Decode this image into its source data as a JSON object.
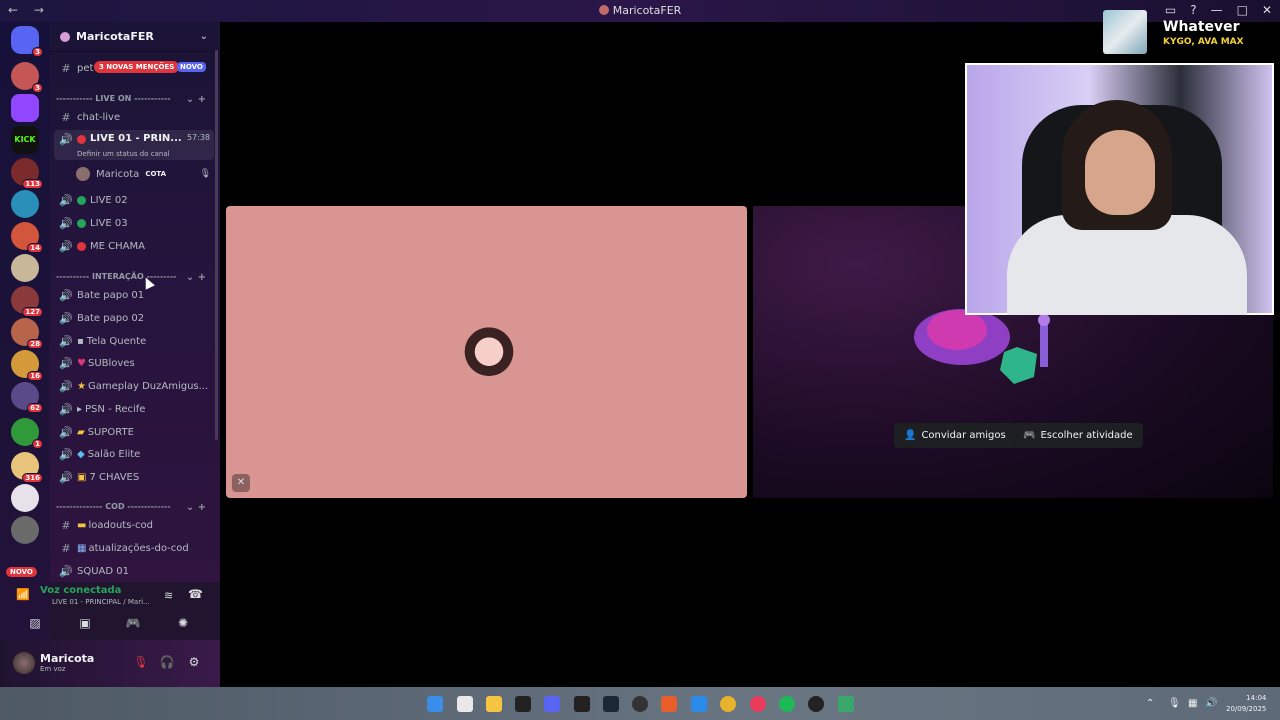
{
  "window": {
    "title": "MaricotaFER",
    "nav": "← →"
  },
  "server": {
    "name": "MaricotaFER"
  },
  "pet_row": {
    "label": "pet",
    "mentions_badge": "3 NOVAS MENÇÕES",
    "new_badge": "NOVO"
  },
  "categories": {
    "live_on": "----------- LIVE ON -----------",
    "interacao": "---------- INTERAÇÃO ---------",
    "cod": "-------------- COD -------------"
  },
  "channels": {
    "chat_live": "chat-live",
    "live01": "LIVE 01 - PRIN...",
    "live01_timer": "57:38",
    "live01_status": "Definir um status do canal",
    "member_name": "Maricota",
    "member_tag": "COTA",
    "live02": "LIVE 02",
    "live03": "LIVE 03",
    "me_chama": "ME CHAMA",
    "bate01": "Bate papo 01",
    "bate02": "Bate papo 02",
    "tela_quente": "Tela Quente",
    "subloves": "SUBloves",
    "gameplay": "Gameplay DuzAmigus...",
    "psn": "PSN - Recife",
    "suporte": "SUPORTE",
    "salao": "Salão Elite",
    "chaves": "7 CHAVES",
    "loadouts": "loadouts-cod",
    "atualizacoes": "atualizações-do-cod",
    "squad01": "SQUAD 01"
  },
  "guild_badges": [
    "3",
    "3",
    "113",
    "14",
    "127",
    "28",
    "16",
    "62",
    "1",
    "316"
  ],
  "guild_novo": "NOVO",
  "voice": {
    "title": "Voz conectada",
    "subtitle": "LIVE 01 - PRINCIPAL / Mari..."
  },
  "user": {
    "name": "Maricota",
    "status": "Em voz"
  },
  "activity": {
    "invite": "Convidar amigos",
    "choose": "Escolher atividade"
  },
  "now_playing": {
    "title": "Whatever",
    "artist": "KYGO, AVA MAX"
  },
  "clock": {
    "time": "14:04",
    "date": "20/09/2025"
  },
  "colors": {
    "accent": "#5865f2",
    "red": "#e0353d",
    "green": "#23a55a",
    "pink_tile": "#d99592",
    "song": "#f5d23a"
  }
}
